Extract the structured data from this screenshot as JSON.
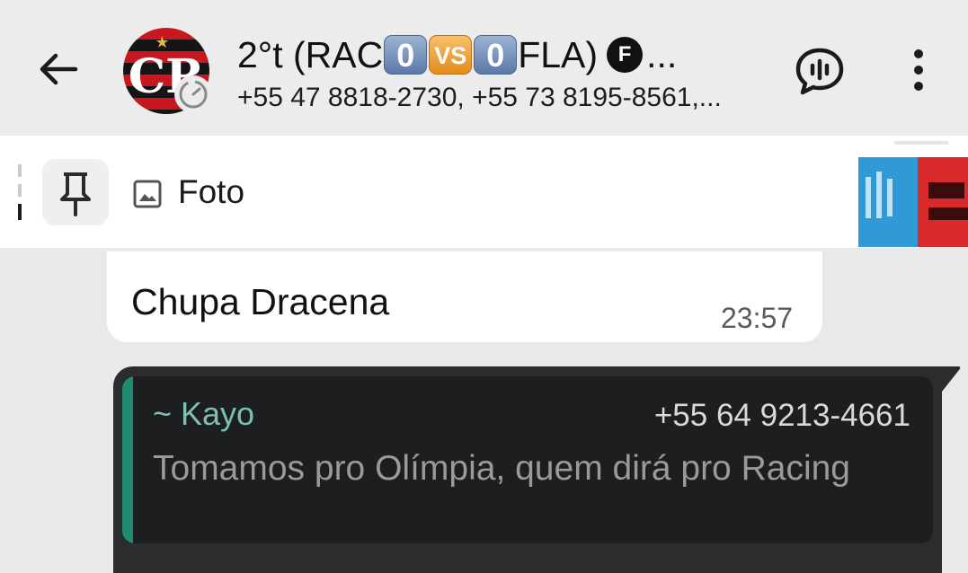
{
  "header": {
    "title_prefix": "2°t (RAC",
    "score_home": "0",
    "vs": "VS",
    "score_away": "0",
    "title_suffix": "FLA)",
    "emoji_letter": "F",
    "title_ellipsis": "...",
    "subtitle": "+55 47 8818-2730, +55 73 8195-8561,..."
  },
  "pinned": {
    "label": "Foto"
  },
  "messages": [
    {
      "text": "Chupa Dracena",
      "time": "23:57"
    }
  ],
  "reply": {
    "author": "~ Kayo",
    "phone": "+55 64 9213-4661",
    "text": "Tomamos pro Olímpia, quem dirá pro Racing"
  },
  "colors": {
    "quote_accent": "#1f8a70",
    "author_name": "#7fbfb0",
    "header_bg": "#ececec",
    "outgoing_bubble": "#2a2c2e"
  },
  "icons": [
    "back-arrow-icon",
    "voice-chat-icon",
    "more-options-icon",
    "pin-icon",
    "photo-icon",
    "timer-badge-icon",
    "flamengo-logo"
  ]
}
